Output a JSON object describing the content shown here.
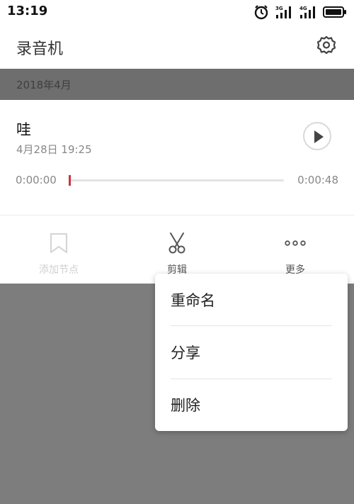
{
  "status_bar": {
    "time": "13:19",
    "network_1": "3G",
    "network_2": "4G"
  },
  "app_bar": {
    "title": "录音机",
    "settings_icon": "gear-icon"
  },
  "group": {
    "title": "2018年4月"
  },
  "recording": {
    "title": "哇",
    "date": "4月28日 19:25",
    "current_time": "0:00:00",
    "total_time": "0:00:48",
    "progress": 0,
    "accent_color": "#c9363b"
  },
  "actions": [
    {
      "label": "添加节点",
      "icon": "bookmark-icon",
      "enabled": false
    },
    {
      "label": "剪辑",
      "icon": "scissors-icon",
      "enabled": true
    },
    {
      "label": "更多",
      "icon": "more-dots-icon",
      "enabled": true
    }
  ],
  "popup_menu": {
    "items": [
      {
        "label": "重命名"
      },
      {
        "label": "分享"
      },
      {
        "label": "删除"
      }
    ]
  }
}
